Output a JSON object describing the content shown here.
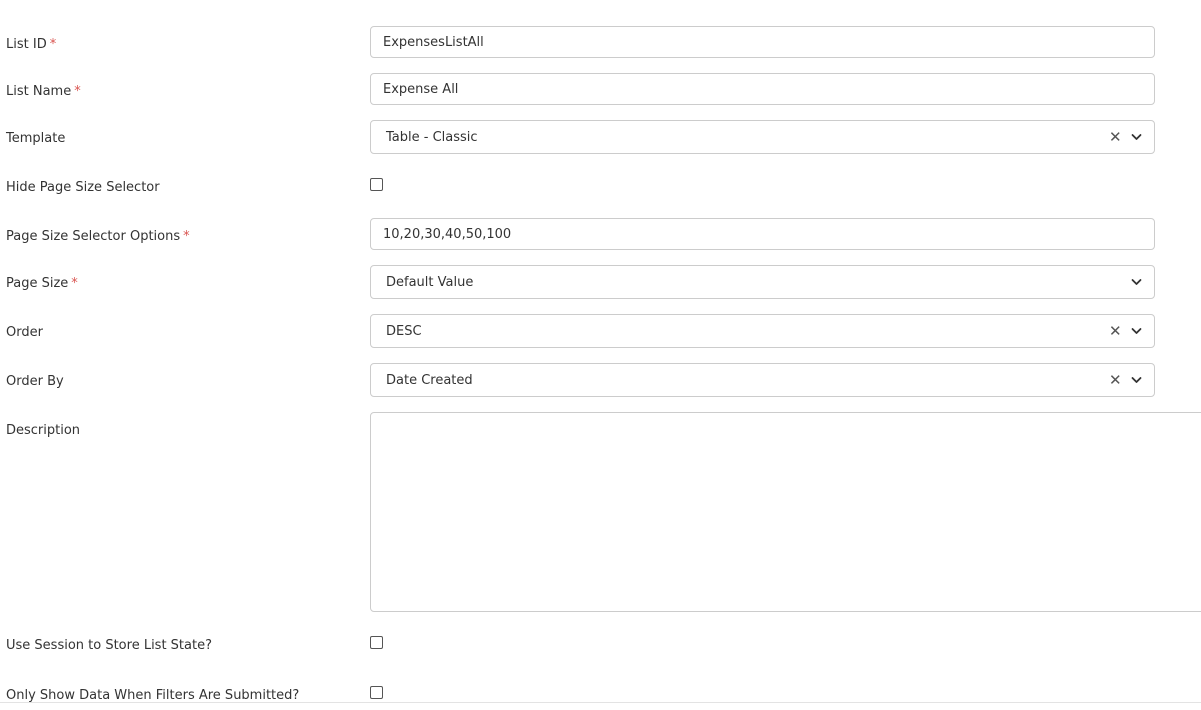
{
  "form": {
    "list_id": {
      "label": "List ID",
      "required_mark": "*",
      "value": "ExpensesListAll"
    },
    "list_name": {
      "label": "List Name",
      "required_mark": "*",
      "value": "Expense All"
    },
    "template": {
      "label": "Template",
      "selected": "Table - Classic",
      "clear_glyph": "✕"
    },
    "hide_page_size_selector": {
      "label": "Hide Page Size Selector",
      "checked": false
    },
    "page_size_selector_options": {
      "label": "Page Size Selector Options",
      "required_mark": "*",
      "value": "10,20,30,40,50,100"
    },
    "page_size": {
      "label": "Page Size",
      "required_mark": "*",
      "selected": "Default Value"
    },
    "order": {
      "label": "Order",
      "selected": "DESC",
      "clear_glyph": "✕"
    },
    "order_by": {
      "label": "Order By",
      "selected": "Date Created",
      "clear_glyph": "✕"
    },
    "description": {
      "label": "Description",
      "value": ""
    },
    "use_session": {
      "label": "Use Session to Store List State?",
      "checked": false
    },
    "only_show_data": {
      "label": "Only Show Data When Filters Are Submitted?",
      "checked": false
    }
  },
  "icons": {
    "clear": "clear-icon",
    "dropdown": "chevron-down-icon"
  },
  "colors": {
    "required": "#d9534f",
    "border": "#cccccc",
    "text": "#333333"
  }
}
